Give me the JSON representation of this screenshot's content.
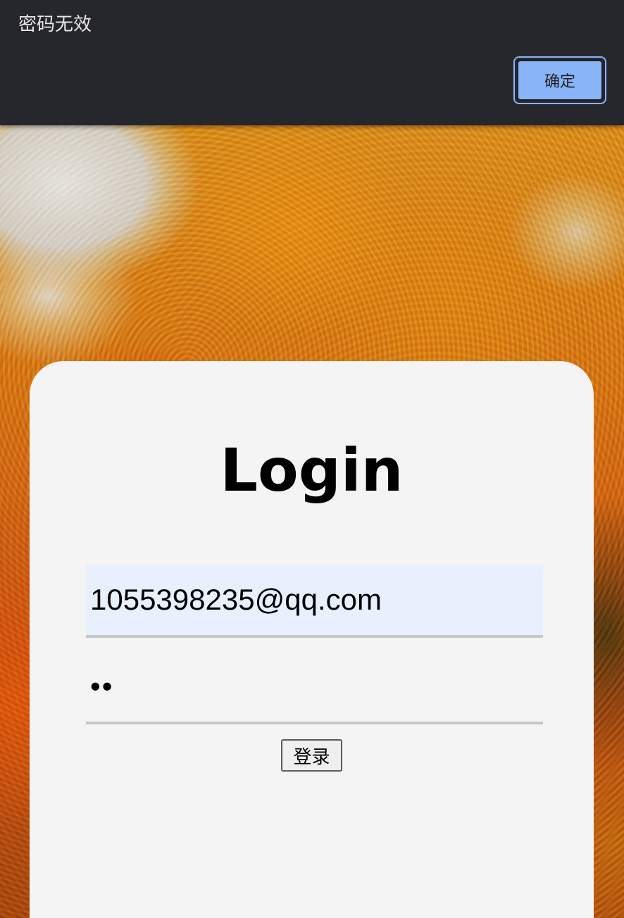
{
  "alert": {
    "message": "密码无效",
    "ok_label": "确定"
  },
  "login": {
    "title": "Login",
    "email_value": "1055398235@qq.com",
    "password_value": "••",
    "submit_label": "登录"
  },
  "colors": {
    "alert_background": "#26272c",
    "ok_button": "#8ab4f8",
    "card_background": "#f4f4f4",
    "autofill_background": "#e8f0fe"
  },
  "icons": {
    "background": "autumn-tree-image"
  }
}
